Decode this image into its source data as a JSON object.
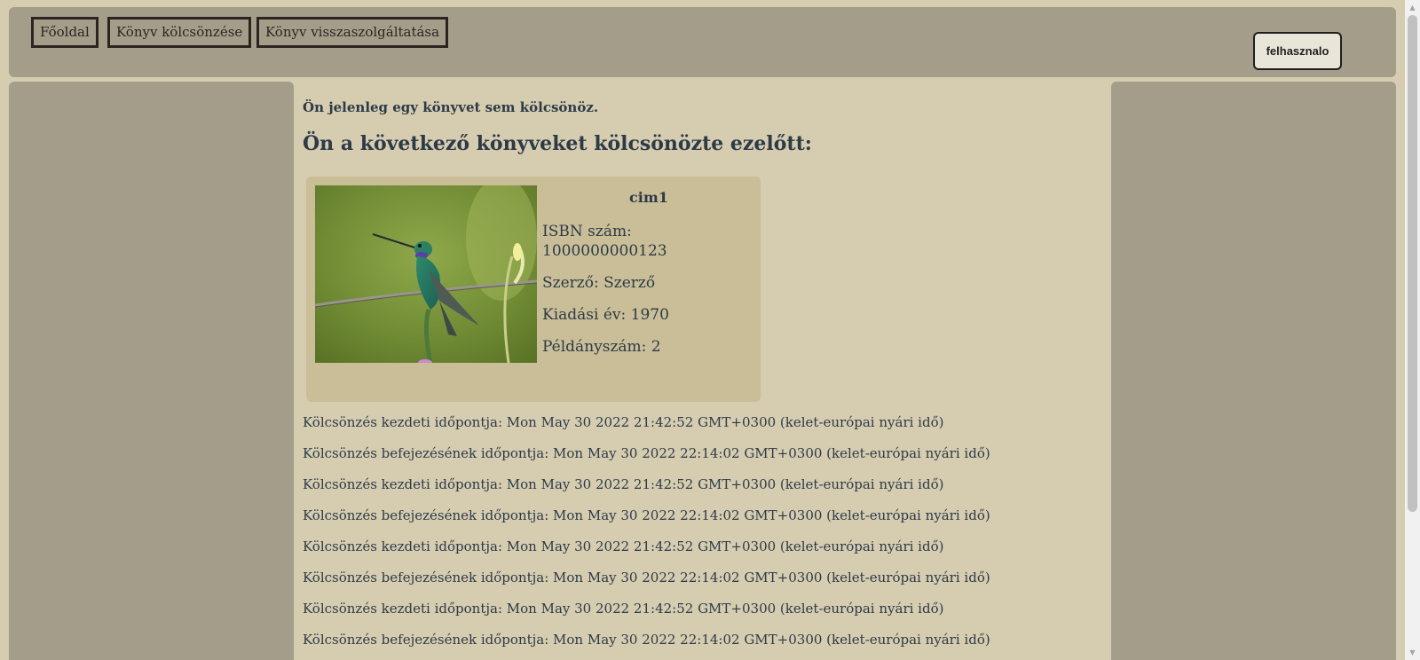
{
  "nav": {
    "home_label": "Főoldal",
    "borrow_label": "Könyv kölcsönzése",
    "return_label": "Könyv visszaszolgáltatása",
    "user_label": "felhasznalo"
  },
  "main": {
    "status": "Ön jelenleg egy könyvet sem kölcsönöz.",
    "history_title": "Ön a következő könyveket kölcsönözte ezelőtt:",
    "book": {
      "title": "cim1",
      "isbn": "ISBN szám: 1000000000123",
      "author": "Szerző: Szerző",
      "year": "Kiadási év: 1970",
      "copies": "Példányszám: 2",
      "image_subject": "hummingbird-photo"
    },
    "loans": [
      "Kölcsönzés kezdeti időpontja: Mon May 30 2022 21:42:52 GMT+0300 (kelet-európai nyári idő)",
      "Kölcsönzés befejezésének időpontja: Mon May 30 2022 22:14:02 GMT+0300 (kelet-európai nyári idő)",
      "Kölcsönzés kezdeti időpontja: Mon May 30 2022 21:42:52 GMT+0300 (kelet-európai nyári idő)",
      "Kölcsönzés befejezésének időpontja: Mon May 30 2022 22:14:02 GMT+0300 (kelet-európai nyári idő)",
      "Kölcsönzés kezdeti időpontja: Mon May 30 2022 21:42:52 GMT+0300 (kelet-európai nyári idő)",
      "Kölcsönzés befejezésének időpontja: Mon May 30 2022 22:14:02 GMT+0300 (kelet-európai nyári idő)",
      "Kölcsönzés kezdeti időpontja: Mon May 30 2022 21:42:52 GMT+0300 (kelet-európai nyári idő)",
      "Kölcsönzés befejezésének időpontja: Mon May 30 2022 22:14:02 GMT+0300 (kelet-európai nyári idő)"
    ]
  },
  "colors": {
    "page_background": "#d6ccb0",
    "panel_background": "#a39d8a",
    "card_background": "#c9be97",
    "text": "#2c3b47"
  }
}
